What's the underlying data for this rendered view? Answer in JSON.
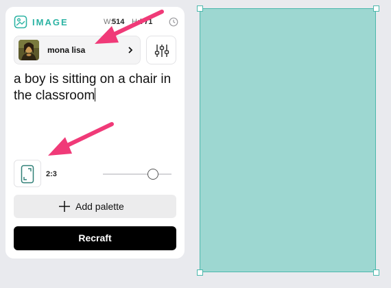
{
  "header": {
    "title": "IMAGE",
    "width_label": "W:",
    "width_value": "514",
    "height_label": "H:",
    "height_value": "771",
    "icons": {
      "logo": "image-icon",
      "history": "clock-icon"
    }
  },
  "style": {
    "name": "mona lisa",
    "thumbnail": "mona-lisa-thumbnail",
    "chevron": "chevron-right-icon",
    "adjust_icon": "sliders-icon"
  },
  "prompt": {
    "text": "a boy is sitting on a chair in the classroom"
  },
  "aspect": {
    "ratio_label": "2:3",
    "ratio_icon": "portrait-frame-icon",
    "slider_value": 0.73
  },
  "actions": {
    "palette_label": "Add palette",
    "palette_icon": "plus-icon",
    "generate_label": "Recraft"
  },
  "colors": {
    "accent": "#2bb3a3",
    "canvas_fill": "#9dd7d1",
    "annotation_arrow": "#f03a78",
    "generate_button": "#000000"
  }
}
